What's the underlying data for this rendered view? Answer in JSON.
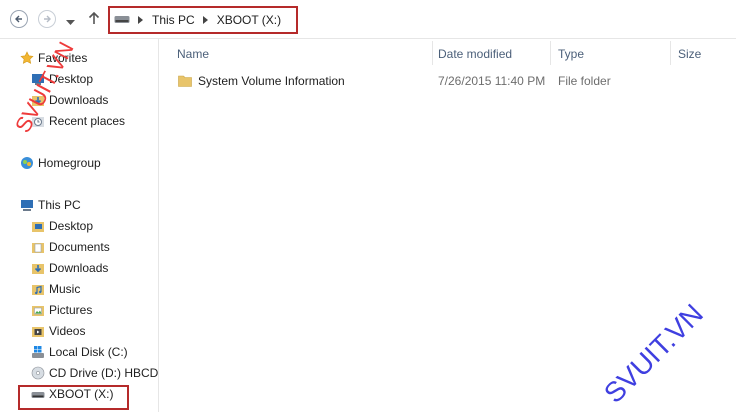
{
  "address_bar": {
    "crumbs": [
      "This PC",
      "XBOOT (X:)"
    ]
  },
  "columns": {
    "name": "Name",
    "date_modified": "Date modified",
    "type": "Type",
    "size": "Size"
  },
  "files": [
    {
      "name": "System Volume Information",
      "date_modified": "7/26/2015 11:40 PM",
      "type": "File folder",
      "size": ""
    }
  ],
  "nav": {
    "favorites": {
      "label": "Favorites",
      "items": [
        "Desktop",
        "Downloads",
        "Recent places"
      ]
    },
    "homegroup": {
      "label": "Homegroup"
    },
    "this_pc": {
      "label": "This PC",
      "items": [
        "Desktop",
        "Documents",
        "Downloads",
        "Music",
        "Pictures",
        "Videos",
        "Local Disk (C:)",
        "CD Drive (D:) HBCD",
        "XBOOT (X:)"
      ]
    }
  },
  "watermarks": [
    "SVUIT.VN",
    "SVUIT.VN"
  ],
  "colors": {
    "highlight_box": "#b52a2a",
    "watermark_red": "#ee3b3b",
    "watermark_blue": "#3f3fe0",
    "folder": "#e8c46a"
  }
}
